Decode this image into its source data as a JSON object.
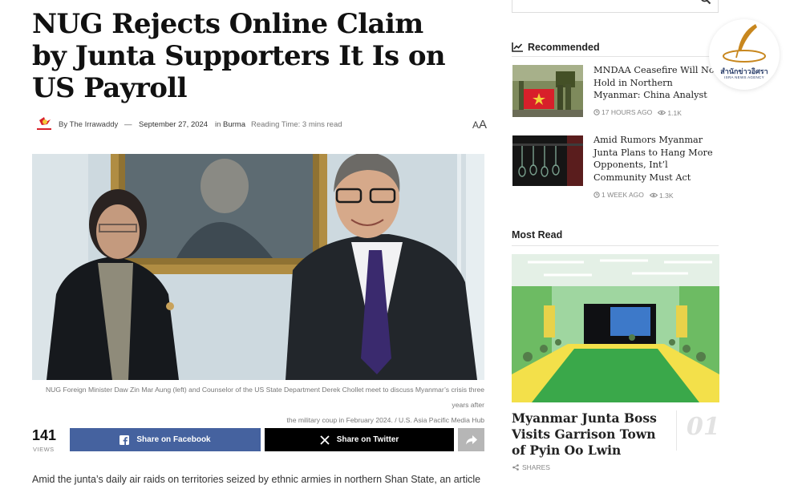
{
  "article": {
    "title": "NUG Rejects Online Claim by Junta Supporters It Is on US Payroll",
    "author_prefix": "By",
    "author": "The Irrawaddy",
    "dash": "—",
    "date": "September 27, 2024",
    "in_label": "in",
    "category": "Burma",
    "reading_time": "Reading Time: 3 mins read",
    "font_size_small": "A",
    "font_size_big": "A",
    "caption_line1": "NUG Foreign Minister Daw Zin Mar Aung (left) and Counselor of the US State Department Derek Chollet meet to discuss Myanmar’s crisis three years after",
    "caption_line2": "the military coup in February 2024. / U.S. Asia Pacific Media Hub",
    "views_count": "141",
    "views_label": "VIEWS",
    "share_facebook": "Share on Facebook",
    "share_twitter": "Share on Twitter",
    "body_start": "Amid the junta’s daily air raids on territories seized by ethnic armies in northern Shan State, an article"
  },
  "sidebar": {
    "search_placeholder": "Search...",
    "recommended_heading": "Recommended",
    "recommended": [
      {
        "title": "MNDAA Ceasefire Will Not Hold in Northern Myanmar: China Analyst",
        "time": "17 HOURS AGO",
        "views": "1.1K"
      },
      {
        "title": "Amid Rumors Myanmar Junta Plans to Hang More Opponents, Int’l Community Must Act",
        "time": "1 WEEK AGO",
        "views": "1.3K"
      }
    ],
    "most_read_heading": "Most Read",
    "most_read": {
      "title": "Myanmar Junta Boss Visits Garrison Town of Pyin Oo Lwin",
      "number": "01",
      "shares_label": "SHARES"
    }
  },
  "watermark": {
    "name": "สำนักข่าวอิศรา",
    "sub": "ISRA NEWS AGENCY"
  },
  "colors": {
    "facebook": "#45629f",
    "twitter": "#000000",
    "share_more": "#b6b6b6",
    "flag_red": "#d8202a",
    "flag_star": "#f3d23a"
  }
}
